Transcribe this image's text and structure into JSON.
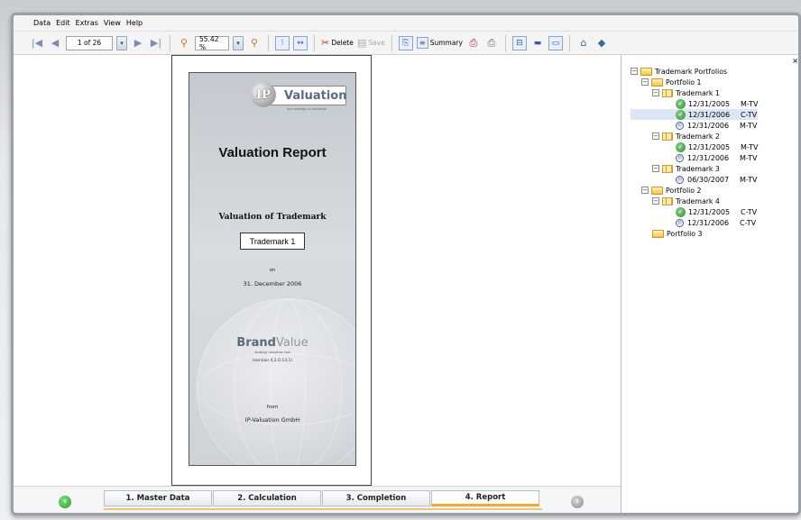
{
  "menu": [
    "Data",
    "Edit",
    "Extras",
    "View",
    "Help"
  ],
  "toolbar": {
    "page_indicator": "1 of 26",
    "zoom": "55.42 %",
    "delete_label": "Delete",
    "save_label": "Save",
    "summary_label": "Summary"
  },
  "report": {
    "logo_text": "Valuation",
    "logo_initials": "IP",
    "logo_tagline": "one strategy of valuation",
    "title": "Valuation Report",
    "subtitle": "Valuation of Trademark",
    "trademark": "Trademark 1",
    "on_label": "on",
    "date": "31. December 2006",
    "brandvalue_bold": "Brand",
    "brandvalue_light": "Value",
    "brandvalue_tag": "strategy valuation tool",
    "version": "(version 4.2.0.13.1)",
    "from_label": "from",
    "company": "IP-Valuation GmbH"
  },
  "tree": {
    "close_label": "×",
    "root": "Trademark Portfolios",
    "portfolio1": "Portfolio 1",
    "tm1": "Trademark 1",
    "tm1_leaf1_date": "12/31/2005",
    "tm1_leaf1_code": "M-TV",
    "tm1_leaf2_date": "12/31/2006",
    "tm1_leaf2_code": "C-TV",
    "tm1_leaf3_date": "12/31/2006",
    "tm1_leaf3_code": "M-TV",
    "tm2": "Trademark 2",
    "tm2_leaf1_date": "12/31/2005",
    "tm2_leaf1_code": "M-TV",
    "tm2_leaf2_date": "12/31/2006",
    "tm2_leaf2_code": "M-TV",
    "tm3": "Trademark 3",
    "tm3_leaf1_date": "06/30/2007",
    "tm3_leaf1_code": "M-TV",
    "portfolio2": "Portfolio 2",
    "tm4": "Trademark 4",
    "tm4_leaf1_date": "12/31/2005",
    "tm4_leaf1_code": "C-TV",
    "tm4_leaf2_date": "12/31/2006",
    "tm4_leaf2_code": "C-TV",
    "portfolio3": "Portfolio 3"
  },
  "tabs": {
    "t1": "1. Master Data",
    "t2": "2. Calculation",
    "t3": "3. Completion",
    "t4": "4. Report"
  },
  "colors": {
    "active_tab_accent": "#f2a93a",
    "nav_prev": "#2a9a34"
  }
}
